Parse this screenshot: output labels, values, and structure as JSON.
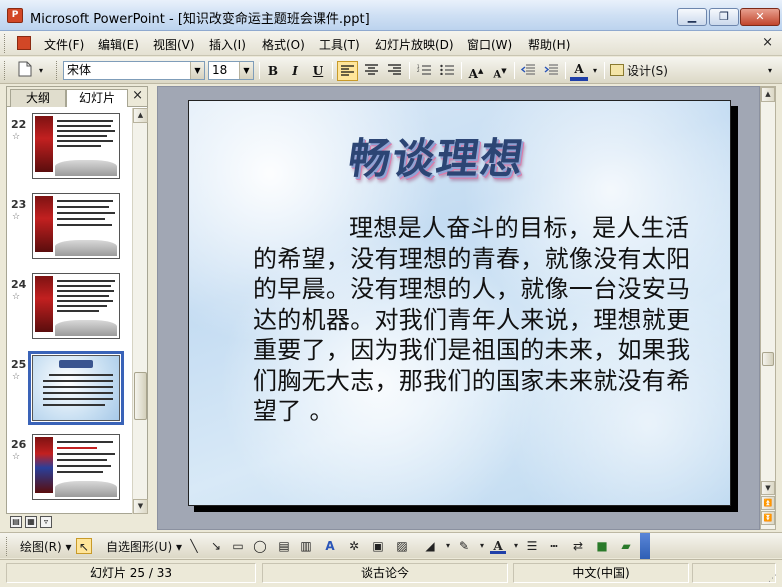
{
  "window": {
    "app_icon": "powerpoint-icon",
    "title": "Microsoft PowerPoint - [知识改变命运主题班会课件.ppt]",
    "minimize_glyph": "▁",
    "restore_glyph": "❐",
    "close_glyph": "✕"
  },
  "menu": {
    "items": [
      "文件(F)",
      "编辑(E)",
      "视图(V)",
      "插入(I)",
      "格式(O)",
      "工具(T)",
      "幻灯片放映(D)",
      "窗口(W)",
      "帮助(H)"
    ],
    "doc_close_glyph": "×"
  },
  "toolbar": {
    "font_name": "宋体",
    "font_size": "18",
    "bold": "B",
    "italic": "I",
    "underline": "U",
    "align_left_icon": "align-left-icon",
    "design_label": "设计(S)"
  },
  "left_pane": {
    "tabs": [
      "大纲",
      "幻灯片"
    ],
    "active_tab": "幻灯片",
    "close_glyph": "×",
    "slides": [
      {
        "number": "22",
        "kind": "red"
      },
      {
        "number": "23",
        "kind": "red"
      },
      {
        "number": "24",
        "kind": "red"
      },
      {
        "number": "25",
        "kind": "blue",
        "selected": true
      },
      {
        "number": "26",
        "kind": "red"
      }
    ]
  },
  "slide": {
    "title": "畅谈理想",
    "body": "理想是人奋斗的目标，是人生活的希望，没有理想的青春，就像没有太阳的早晨。没有理想的人，就像一台没安马达的机器。对我们青年人来说，理想就更重要了，因为我们是祖国的未来，如果我们胸无大志，那我们的国家未来就没有希望了 。"
  },
  "drawing_toolbar": {
    "draw_label": "绘图(R)",
    "autoshape_label": "自选图形(U)"
  },
  "status": {
    "slide_indicator": "幻灯片 25 / 33",
    "design_template": "谈古论今",
    "language": "中文(中国)"
  }
}
